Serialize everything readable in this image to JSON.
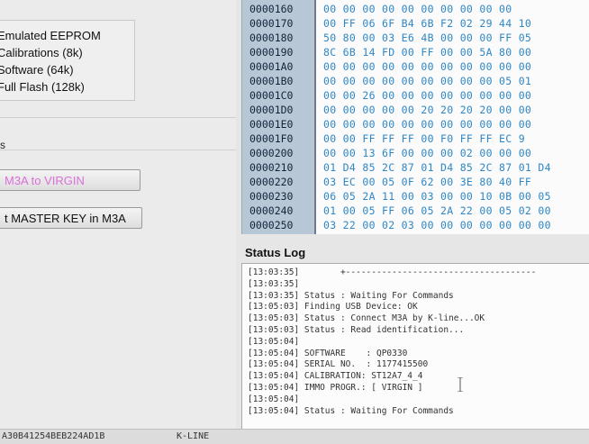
{
  "memory_options": {
    "items": [
      "Emulated EEPROM",
      "Calibrations (8k)",
      "Software (64k)",
      "Full Flash (128k)"
    ]
  },
  "section_label": "s",
  "buttons": {
    "virgin": "M3A to VIRGIN",
    "master_key": "t MASTER KEY in M3A"
  },
  "hex": {
    "rows": [
      {
        "addr": "0000160",
        "bytes": "00 00 00 00 00 00 00 00 00 00"
      },
      {
        "addr": "0000170",
        "bytes": "00 FF 06 6F B4 6B F2 02 29 44 10"
      },
      {
        "addr": "0000180",
        "bytes": "50 80 00 03 E6 4B 00 00 00 FF 05"
      },
      {
        "addr": "0000190",
        "bytes": "8C 6B 14 FD 00 FF 00 00 5A 80 00"
      },
      {
        "addr": "00001A0",
        "bytes": "00 00 00 00 00 00 00 00 00 00 00"
      },
      {
        "addr": "00001B0",
        "bytes": "00 00 00 00 00 00 00 00 00 05 01"
      },
      {
        "addr": "00001C0",
        "bytes": "00 00 26 00 00 00 00 00 00 00 00"
      },
      {
        "addr": "00001D0",
        "bytes": "00 00 00 00 00 20 20 20 20 00 00"
      },
      {
        "addr": "00001E0",
        "bytes": "00 00 00 00 00 00 00 00 00 00 00"
      },
      {
        "addr": "00001F0",
        "bytes": "00 00 FF FF FF 00 F0 FF FF EC 9"
      },
      {
        "addr": "0000200",
        "bytes": "00 00 13 6F 00 00 00 02 00 00 00"
      },
      {
        "addr": "0000210",
        "bytes": "01 D4 85 2C 87 01 D4 85 2C 87 01 D4"
      },
      {
        "addr": "0000220",
        "bytes": "03 EC 00 05 0F 62 00 3E 80 40 FF"
      },
      {
        "addr": "0000230",
        "bytes": "06 05 2A 11 00 03 00 00 10 0B 00 05"
      },
      {
        "addr": "0000240",
        "bytes": "01 00 05 FF 06 05 2A 22 00 05 02 00"
      },
      {
        "addr": "0000250",
        "bytes": "03 22 00 02 03 00 00 00 00 00 00 00"
      }
    ]
  },
  "status_log": {
    "title": "Status Log",
    "lines": [
      "[13:03:35]        +-------------------------------------",
      "[13:03:35]",
      "[13:03:35] Status : Waiting For Commands",
      "[13:05:03] Finding USB Device: OK",
      "[13:05:03] Status : Connect M3A by K-line...OK",
      "[13:05:03] Status : Read identification...",
      "[13:05:04]",
      "[13:05:04] SOFTWARE    : QP0330",
      "[13:05:04] SERIAL NO.  : 1177415500",
      "[13:05:04] CALIBRATION: ST12A7_4_4",
      "[13:05:04] IMMO PROGR.: [ VIRGIN ]",
      "[13:05:04]",
      "[13:05:04] Status : Waiting For Commands"
    ]
  },
  "status_bar": {
    "left": "A30B41254BEB224AD1B",
    "right": "K-LINE"
  },
  "colors": {
    "hex_bytes": "#2f86c5",
    "address_column": "#b7c7d6",
    "virgin_button_text": "#d870d8"
  }
}
